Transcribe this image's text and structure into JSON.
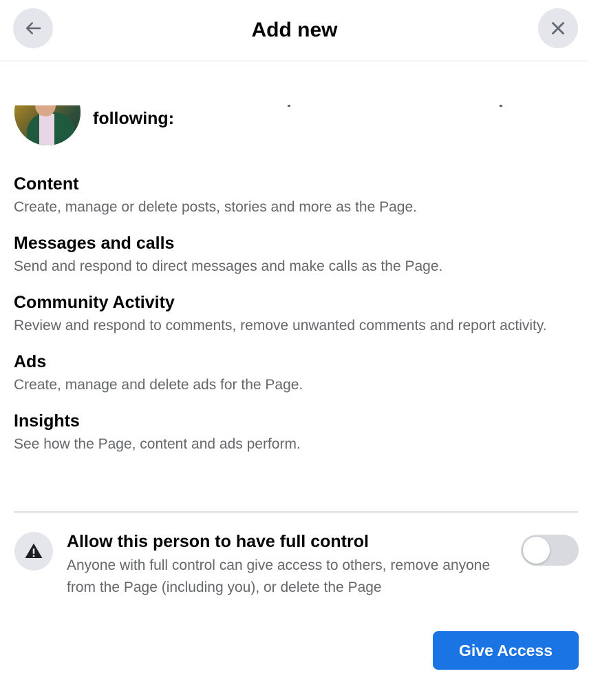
{
  "header": {
    "title": "Add new",
    "back_icon": "arrow-left-icon",
    "close_icon": "close-icon"
  },
  "intro": {
    "text": "following:"
  },
  "permissions": [
    {
      "title": "Content",
      "description": "Create, manage or delete posts, stories and more as the Page."
    },
    {
      "title": "Messages and calls",
      "description": "Send and respond to direct messages and make calls as the Page."
    },
    {
      "title": "Community Activity",
      "description": "Review and respond to comments, remove unwanted comments and report activity."
    },
    {
      "title": "Ads",
      "description": "Create, manage and delete ads for the Page."
    },
    {
      "title": "Insights",
      "description": "See how the Page, content and ads perform."
    }
  ],
  "full_control": {
    "title": "Allow this person to have full control",
    "description": "Anyone with full control can give access to others, remove anyone from the Page (including you), or delete the Page",
    "icon": "warning-icon",
    "enabled": false
  },
  "actions": {
    "give_access_label": "Give Access"
  },
  "colors": {
    "primary": "#1b74e4",
    "secondary_text": "#65676b",
    "button_bg": "#e4e6eb"
  }
}
